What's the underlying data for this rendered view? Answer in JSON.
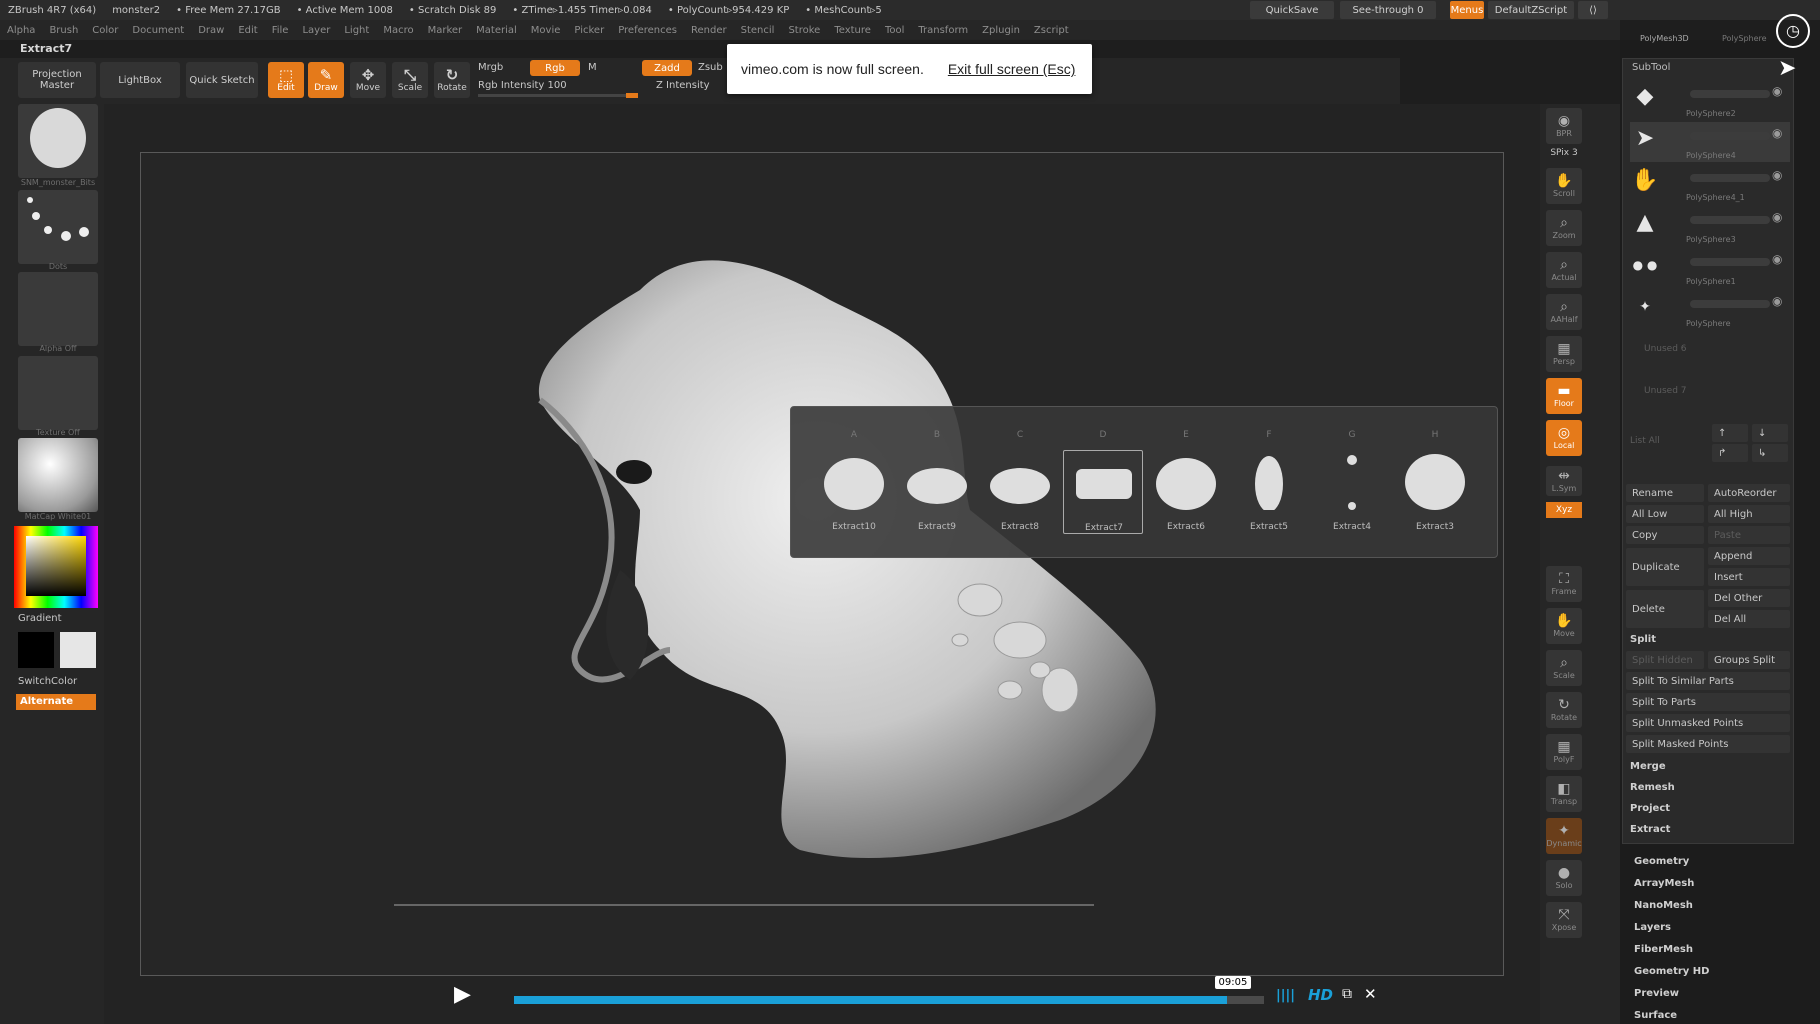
{
  "status": {
    "app": "ZBrush 4R7 (x64)",
    "doc": "monster2",
    "free_mem": "• Free Mem 27.17GB",
    "active_mem": "• Active Mem 1008",
    "scratch": "• Scratch Disk 89",
    "ztime": "• ZTime▹1.455 Timer▹0.084",
    "polycount": "• PolyCount▹954.429 KP",
    "meshcount": "• MeshCount▹5",
    "quicksave": "QuickSave",
    "seethrough": "See-through  0",
    "menus": "Menus",
    "defaultzscript": "DefaultZScript"
  },
  "menubar": [
    "Alpha",
    "Brush",
    "Color",
    "Document",
    "Draw",
    "Edit",
    "File",
    "Layer",
    "Light",
    "Macro",
    "Marker",
    "Material",
    "Movie",
    "Picker",
    "Preferences",
    "Render",
    "Stencil",
    "Stroke",
    "Texture",
    "Tool",
    "Transform",
    "Zplugin",
    "Zscript"
  ],
  "tool_name": "Extract7",
  "toolbar": {
    "projection_master": "Projection Master",
    "lightbox": "LightBox",
    "quick_sketch": "Quick Sketch",
    "edit": "Edit",
    "draw": "Draw",
    "move": "Move",
    "scale": "Scale",
    "rotate": "Rotate",
    "mrgb": "Mrgb",
    "rgb": "Rgb",
    "m": "M",
    "rgb_intensity": "Rgb Intensity 100",
    "zadd": "Zadd",
    "zsub": "Zsub",
    "z_intensity": "Z Intensity"
  },
  "fullscreen_notice": {
    "message": "vimeo.com is now full screen.",
    "exit": "Exit full screen (Esc)"
  },
  "left_shelf": {
    "brush_label": "SNM_monster_Bits",
    "stroke_label": "Dots",
    "alpha_label": "Alpha  Off",
    "texture_label": "Texture  Off",
    "material_label": "MatCap  White01",
    "gradient": "Gradient",
    "switchcolor": "SwitchColor",
    "alternate": "Alternate"
  },
  "right_shelf": [
    "BPR",
    "SPix 3",
    "Scroll",
    "Zoom",
    "Actual",
    "AAHalf",
    "Persp",
    "Floor",
    "Local",
    "L.Sym",
    "Xyz",
    "Frame",
    "Move",
    "Scale",
    "Rotate",
    "PolyF",
    "Transp",
    "Dynamic",
    "Solo",
    "Xpose"
  ],
  "subtool": {
    "title": "SubTool",
    "items": [
      {
        "name": "PolySphere2"
      },
      {
        "name": "PolySphere4"
      },
      {
        "name": "PolySphere4_1"
      },
      {
        "name": "PolySphere3"
      },
      {
        "name": "PolySphere1"
      },
      {
        "name": "PolySphere"
      }
    ],
    "empty_slots": [
      "Unused 6",
      "Unused 7"
    ],
    "list_all": "List  All",
    "buttons": {
      "rename": "Rename",
      "autoreorder": "AutoReorder",
      "all_low": "All Low",
      "all_high": "All High",
      "copy": "Copy",
      "paste": "Paste",
      "duplicate": "Duplicate",
      "append": "Append",
      "insert": "Insert",
      "delete": "Delete",
      "del_other": "Del Other",
      "del_all": "Del All"
    },
    "split": {
      "title": "Split",
      "split_hidden": "Split Hidden",
      "groups_split": "Groups Split",
      "to_similar": "Split To Similar Parts",
      "to_parts": "Split To Parts",
      "unmasked": "Split Unmasked Points",
      "masked": "Split Masked Points"
    },
    "merge": "Merge",
    "remesh": "Remesh",
    "project": "Project",
    "extract": "Extract"
  },
  "tool_menus": [
    "Geometry",
    "ArrayMesh",
    "NanoMesh",
    "Layers",
    "FiberMesh",
    "Geometry HD",
    "Preview",
    "Surface"
  ],
  "tool_header": {
    "polymesh3d": "PolyMesh3D",
    "polysphere": "PolySphere"
  },
  "extract_popup": {
    "letters": [
      "A",
      "B",
      "C",
      "D",
      "E",
      "F",
      "G",
      "H"
    ],
    "items": [
      "Extract10",
      "Extract9",
      "Extract8",
      "Extract7",
      "Extract6",
      "Extract5",
      "Extract4",
      "Extract3"
    ],
    "selected_index": 3
  },
  "player": {
    "time": "09:05",
    "hd": "HD",
    "progress": 0.95
  }
}
